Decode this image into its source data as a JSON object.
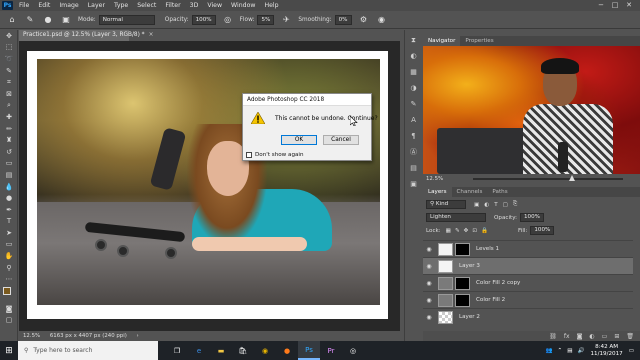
{
  "app": {
    "menu": [
      "File",
      "Edit",
      "Image",
      "Layer",
      "Type",
      "Select",
      "Filter",
      "3D",
      "View",
      "Window",
      "Help"
    ],
    "window_controls": [
      "−",
      "□",
      "✕"
    ]
  },
  "options_bar": {
    "mode_label": "Mode:",
    "mode_value": "Normal",
    "opacity_label": "Opacity:",
    "opacity_value": "100%",
    "flow_label": "Flow:",
    "flow_value": "5%",
    "smoothing_label": "Smoothing:",
    "smoothing_value": "0%"
  },
  "document": {
    "tab_title": "Practice1.psd @ 12.5% (Layer 3, RGB/8) *",
    "status_zoom": "12.5%",
    "status_info": "6163 px x 4407 px (240 ppi)"
  },
  "dialog": {
    "title": "Adobe Photoshop CC 2018",
    "message": "This cannot be undone.  Continue?",
    "ok_label": "OK",
    "cancel_label": "Cancel",
    "checkbox_label": "Don't show again"
  },
  "navigator": {
    "tabs": [
      "Navigator",
      "Properties"
    ],
    "zoom": "12.5%"
  },
  "layers": {
    "tabs": [
      "Layers",
      "Channels",
      "Paths"
    ],
    "filter_label": "Kind",
    "blend_mode": "Lighten",
    "opacity_label": "Opacity:",
    "opacity_value": "100%",
    "lock_label": "Lock:",
    "fill_label": "Fill:",
    "fill_value": "100%",
    "items": [
      {
        "name": "Levels 1"
      },
      {
        "name": "Layer 3"
      },
      {
        "name": "Color Fill 2 copy"
      },
      {
        "name": "Color Fill 2"
      },
      {
        "name": "Layer 2"
      }
    ]
  },
  "taskbar": {
    "search_placeholder": "Type here to search",
    "time": "8:42 AM",
    "date": "11/19/2017"
  }
}
